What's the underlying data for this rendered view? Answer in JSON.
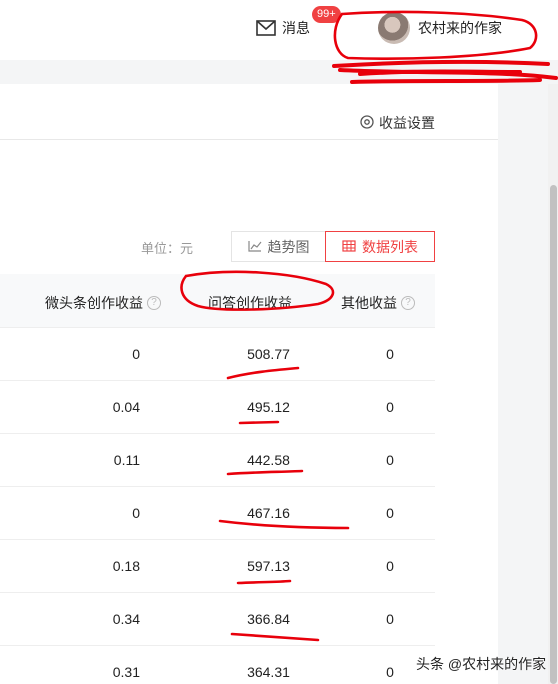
{
  "header": {
    "message_label": "消息",
    "message_badge": "99+",
    "username": "农村来的作家"
  },
  "settings": {
    "label": "收益设置"
  },
  "unit_label": "单位：元",
  "view_toggle": {
    "trend_label": "趋势图",
    "list_label": "数据列表"
  },
  "table": {
    "columns": [
      "微头条创作收益",
      "问答创作收益",
      "其他收益"
    ],
    "rows": [
      {
        "weitoutiao": "0",
        "wenda": "508.77",
        "other": "0"
      },
      {
        "weitoutiao": "0.04",
        "wenda": "495.12",
        "other": "0"
      },
      {
        "weitoutiao": "0.11",
        "wenda": "442.58",
        "other": "0"
      },
      {
        "weitoutiao": "0",
        "wenda": "467.16",
        "other": "0"
      },
      {
        "weitoutiao": "0.18",
        "wenda": "597.13",
        "other": "0"
      },
      {
        "weitoutiao": "0.34",
        "wenda": "366.84",
        "other": "0"
      },
      {
        "weitoutiao": "0.31",
        "wenda": "364.31",
        "other": "0"
      }
    ]
  },
  "watermark": "头条 @农村来的作家",
  "colors": {
    "accent": "#f04142",
    "annotation": "#e8000b"
  }
}
